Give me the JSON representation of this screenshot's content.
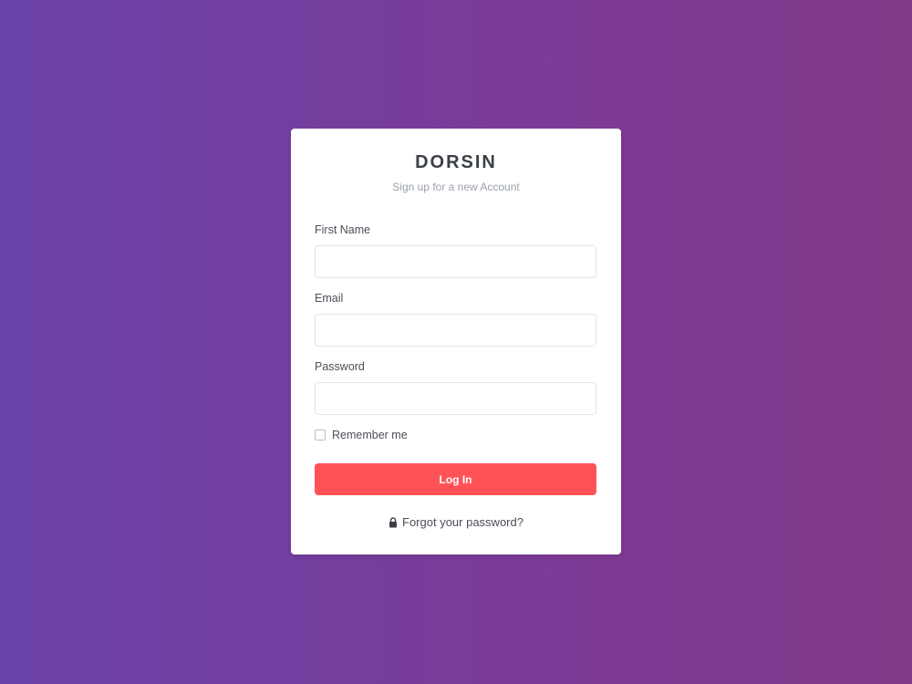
{
  "brand": {
    "name": "DORSIN",
    "subtitle": "Sign up for a new Account"
  },
  "form": {
    "first_name": {
      "label": "First Name",
      "value": "",
      "placeholder": ""
    },
    "email": {
      "label": "Email",
      "value": "",
      "placeholder": ""
    },
    "password": {
      "label": "Password",
      "value": "",
      "placeholder": ""
    },
    "remember_label": "Remember me",
    "remember_checked": false,
    "submit_label": "Log In",
    "forgot_label": "Forgot your password?"
  },
  "icons": {
    "forgot": "lock-icon"
  },
  "colors": {
    "background_start": "#6a42a8",
    "background_end": "#813888",
    "button": "#ff5256",
    "brand_text": "#3b3f46"
  }
}
